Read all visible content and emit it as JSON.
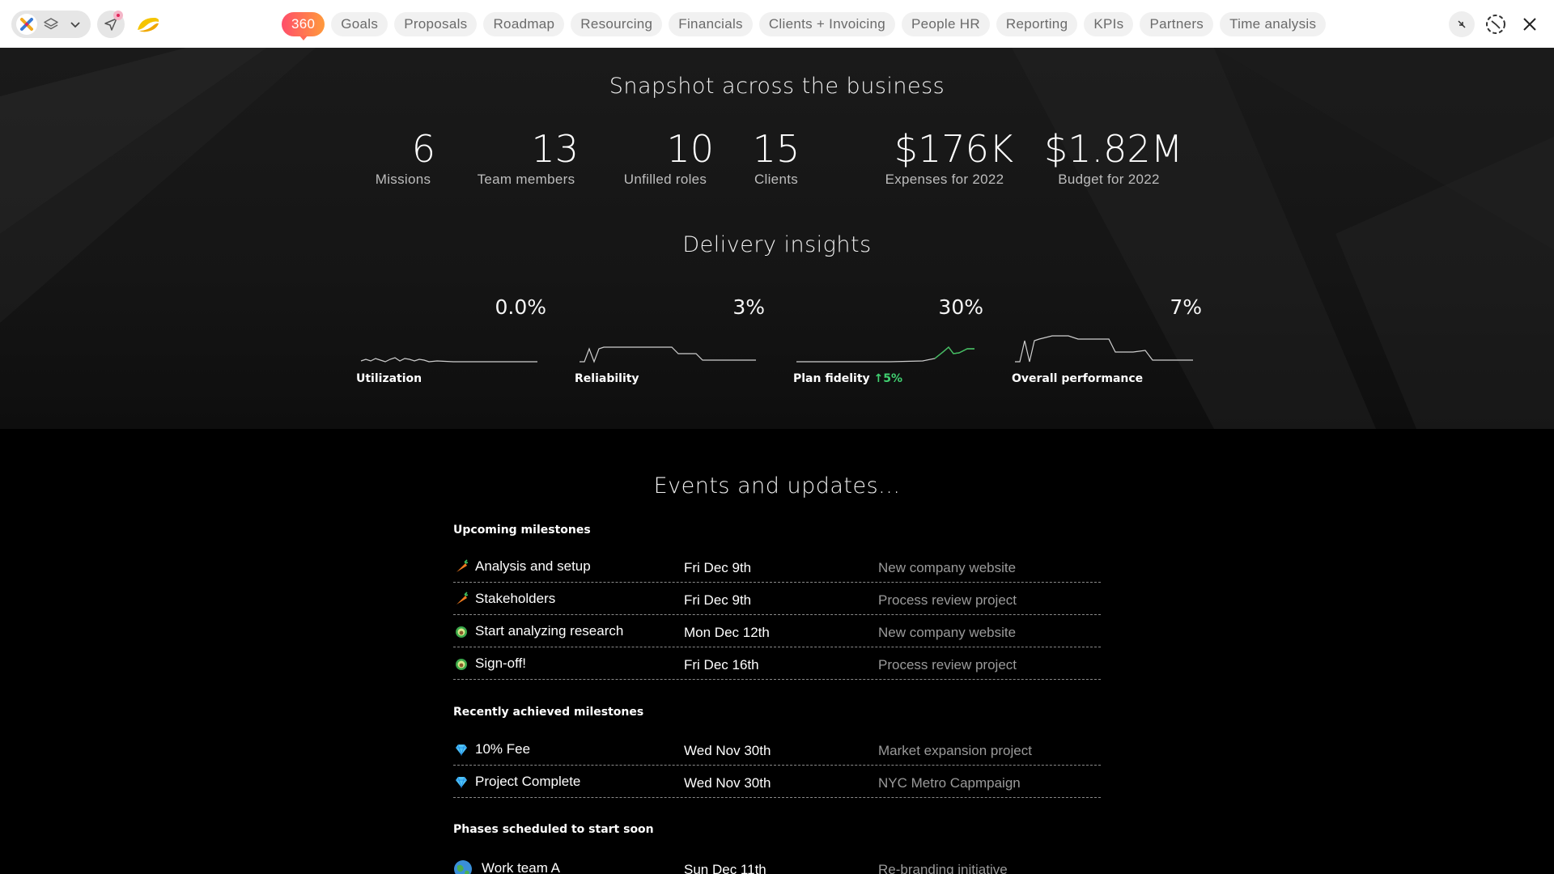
{
  "nav": {
    "tabs": [
      "360",
      "Goals",
      "Proposals",
      "Roadmap",
      "Resourcing",
      "Financials",
      "Clients + Invoicing",
      "People HR",
      "Reporting",
      "KPIs",
      "Partners",
      "Time analysis"
    ],
    "active": "360"
  },
  "snapshot": {
    "title": "Snapshot across the business",
    "stats": [
      {
        "value": "6",
        "label": "Missions"
      },
      {
        "value": "13",
        "label": "Team members"
      },
      {
        "value": "10",
        "label": "Unfilled roles"
      },
      {
        "value": "15",
        "label": "Clients"
      },
      {
        "value": "$176K",
        "label": "Expenses for 2022"
      },
      {
        "value": "$1.82M",
        "label": "Budget for 2022"
      }
    ]
  },
  "insights": {
    "title": "Delivery insights",
    "items": [
      {
        "name": "Utilization",
        "value": "0.0%",
        "delta": ""
      },
      {
        "name": "Reliability",
        "value": "3%",
        "delta": ""
      },
      {
        "name": "Plan fidelity",
        "value": "30%",
        "delta": "↑5%"
      },
      {
        "name": "Overall performance",
        "value": "7%",
        "delta": ""
      }
    ]
  },
  "events": {
    "title": "Events and updates...",
    "upcoming_heading": "Upcoming milestones",
    "upcoming": [
      {
        "icon": "carrot-icon",
        "title": "Analysis and setup",
        "date": "Fri Dec 9th",
        "project": "New company website"
      },
      {
        "icon": "carrot-icon",
        "title": "Stakeholders",
        "date": "Fri Dec 9th",
        "project": "Process review project"
      },
      {
        "icon": "avocado-icon",
        "title": "Start analyzing research",
        "date": "Mon Dec 12th",
        "project": "New company website"
      },
      {
        "icon": "avocado-icon",
        "title": "Sign-off!",
        "date": "Fri Dec 16th",
        "project": "Process review project"
      }
    ],
    "achieved_heading": "Recently achieved milestones",
    "achieved": [
      {
        "icon": "diamond-icon",
        "title": "10% Fee",
        "date": "Wed Nov 30th",
        "project": "Market expansion project"
      },
      {
        "icon": "diamond-icon",
        "title": "Project Complete",
        "date": "Wed Nov 30th",
        "project": "NYC Metro Capmpaign"
      }
    ],
    "phases_heading": "Phases scheduled to start soon",
    "phases": [
      {
        "icon": "globe-icon",
        "title": "Work team A",
        "date": "Sun Dec 11th",
        "project": "Re-branding initiative"
      }
    ]
  },
  "colors": {
    "accent_gradient_start": "#ff4e6a",
    "accent_gradient_end": "#ff9a3c",
    "positive": "#40d070"
  }
}
